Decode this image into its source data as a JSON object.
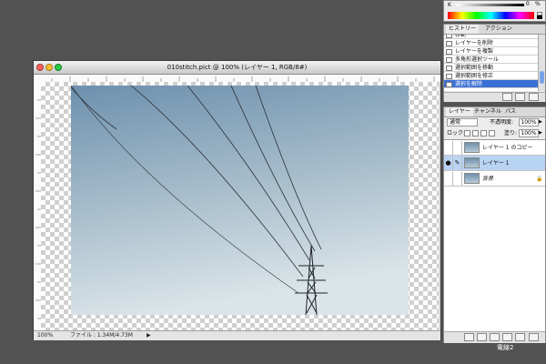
{
  "color_panel": {
    "slider_letter": "K",
    "value": "0",
    "unit": "%"
  },
  "history": {
    "tabs": [
      "ヒストリー",
      "アクション"
    ],
    "items": [
      {
        "label": "移動"
      },
      {
        "label": "レイヤーを削除"
      },
      {
        "label": "レイヤーを複製"
      },
      {
        "label": "多角形選択ツール"
      },
      {
        "label": "選択範囲を移動"
      },
      {
        "label": "選択範囲を修正"
      },
      {
        "label": "選択を解除",
        "selected": true
      }
    ]
  },
  "layers": {
    "tabs": [
      "レイヤー",
      "チャンネル",
      "パス"
    ],
    "blend_mode": "通常",
    "opacity_label": "不透明度:",
    "opacity_value": "100%",
    "lock_label": "ロック:",
    "fill_label": "塗り:",
    "fill_value": "100%",
    "items": [
      {
        "name": "レイヤー 1 のコピー",
        "visible": false,
        "selected": false
      },
      {
        "name": "レイヤー 1",
        "visible": true,
        "selected": true
      },
      {
        "name": "背景",
        "visible": false,
        "selected": false,
        "locked": true
      }
    ]
  },
  "document": {
    "title": "010stitch.pict @ 100% (レイヤー 1, RGB/8#)",
    "zoom": "100%",
    "file_info": "ファイル : 1.34M/4.73M"
  },
  "caption": "電線2",
  "colors": {
    "workspace": "#525252",
    "sky_top": "#6e90ad",
    "sky_bottom": "#dbe5e8",
    "layer_selected": "#b9d3f3",
    "history_selected": "#3a6fd6",
    "close_light": "#ff5f57",
    "minimize_light": "#febc2e",
    "zoom_light": "#28c840"
  }
}
